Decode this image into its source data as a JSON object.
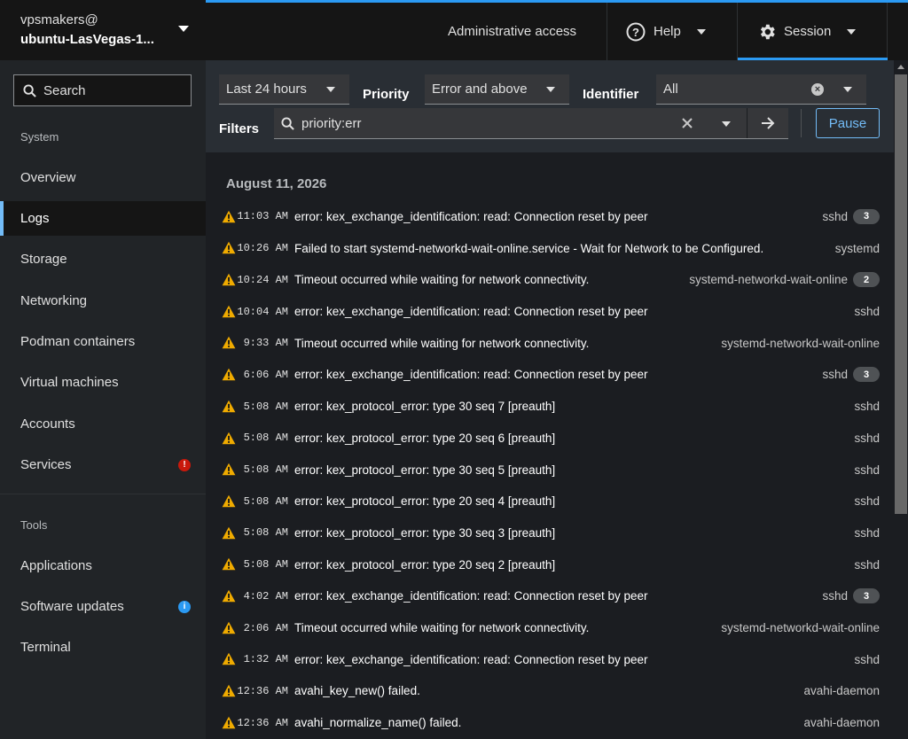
{
  "host": {
    "user": "vpsmakers@",
    "name": "ubuntu-LasVegas-1..."
  },
  "sidebar": {
    "search_placeholder": "Search",
    "system_label": "System",
    "tools_label": "Tools",
    "items": [
      {
        "label": "Overview"
      },
      {
        "label": "Logs"
      },
      {
        "label": "Storage"
      },
      {
        "label": "Networking"
      },
      {
        "label": "Podman containers"
      },
      {
        "label": "Virtual machines"
      },
      {
        "label": "Accounts"
      },
      {
        "label": "Services",
        "badge": "!",
        "badge_color": "#c9190b"
      }
    ],
    "tools": [
      {
        "label": "Applications"
      },
      {
        "label": "Software updates",
        "badge": "i",
        "badge_color": "#2b9af3"
      },
      {
        "label": "Terminal"
      }
    ]
  },
  "topbar": {
    "admin": "Administrative access",
    "help": "Help",
    "session": "Session"
  },
  "filters": {
    "time_range": "Last 24 hours",
    "priority_label": "Priority",
    "priority_value": "Error and above",
    "identifier_label": "Identifier",
    "identifier_value": "All",
    "filters_label": "Filters",
    "filter_text": "priority:err",
    "pause_label": "Pause"
  },
  "logs": {
    "date": "August 11, 2026",
    "entries": [
      {
        "time": "11:03 AM",
        "msg": "error: kex_exchange_identification: read: Connection reset by peer",
        "ident": "sshd",
        "count": "3"
      },
      {
        "time": "10:26 AM",
        "msg": "Failed to start systemd-networkd-wait-online.service - Wait for Network to be Configured.",
        "ident": "systemd",
        "count": ""
      },
      {
        "time": "10:24 AM",
        "msg": "Timeout occurred while waiting for network connectivity.",
        "ident": "systemd-networkd-wait-online",
        "count": "2"
      },
      {
        "time": "10:04 AM",
        "msg": "error: kex_exchange_identification: read: Connection reset by peer",
        "ident": "sshd",
        "count": ""
      },
      {
        "time": "9:33 AM",
        "msg": "Timeout occurred while waiting for network connectivity.",
        "ident": "systemd-networkd-wait-online",
        "count": ""
      },
      {
        "time": "6:06 AM",
        "msg": "error: kex_exchange_identification: read: Connection reset by peer",
        "ident": "sshd",
        "count": "3"
      },
      {
        "time": "5:08 AM",
        "msg": "error: kex_protocol_error: type 30 seq 7 [preauth]",
        "ident": "sshd",
        "count": ""
      },
      {
        "time": "5:08 AM",
        "msg": "error: kex_protocol_error: type 20 seq 6 [preauth]",
        "ident": "sshd",
        "count": ""
      },
      {
        "time": "5:08 AM",
        "msg": "error: kex_protocol_error: type 30 seq 5 [preauth]",
        "ident": "sshd",
        "count": ""
      },
      {
        "time": "5:08 AM",
        "msg": "error: kex_protocol_error: type 20 seq 4 [preauth]",
        "ident": "sshd",
        "count": ""
      },
      {
        "time": "5:08 AM",
        "msg": "error: kex_protocol_error: type 30 seq 3 [preauth]",
        "ident": "sshd",
        "count": ""
      },
      {
        "time": "5:08 AM",
        "msg": "error: kex_protocol_error: type 20 seq 2 [preauth]",
        "ident": "sshd",
        "count": ""
      },
      {
        "time": "4:02 AM",
        "msg": "error: kex_exchange_identification: read: Connection reset by peer",
        "ident": "sshd",
        "count": "3"
      },
      {
        "time": "2:06 AM",
        "msg": "Timeout occurred while waiting for network connectivity.",
        "ident": "systemd-networkd-wait-online",
        "count": ""
      },
      {
        "time": "1:32 AM",
        "msg": "error: kex_exchange_identification: read: Connection reset by peer",
        "ident": "sshd",
        "count": ""
      },
      {
        "time": "12:36 AM",
        "msg": "avahi_key_new() failed.",
        "ident": "avahi-daemon",
        "count": ""
      },
      {
        "time": "12:36 AM",
        "msg": "avahi_normalize_name() failed.",
        "ident": "avahi-daemon",
        "count": ""
      }
    ]
  },
  "colors": {
    "accent": "#2b9af3",
    "warning": "#f0ab00",
    "danger": "#c9190b"
  }
}
